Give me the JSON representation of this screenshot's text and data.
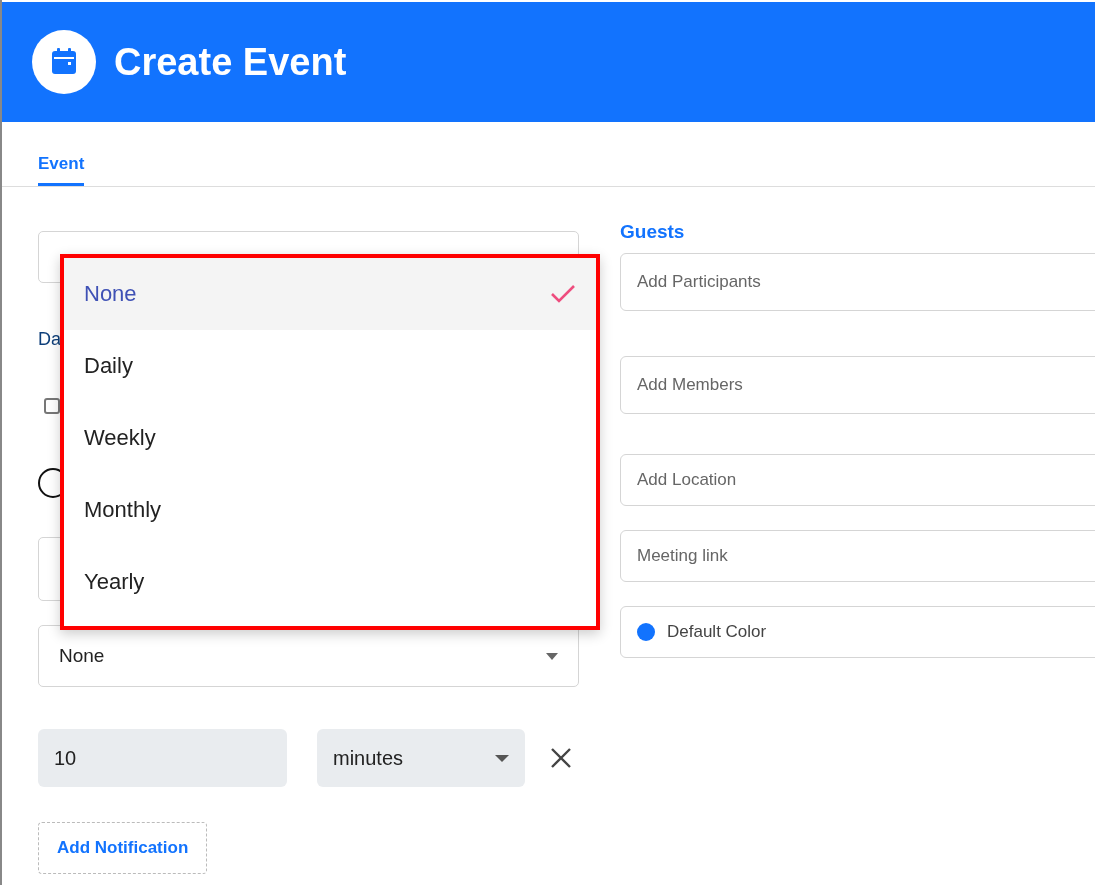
{
  "header": {
    "title": "Create Event"
  },
  "tabs": [
    {
      "label": "Event",
      "selected": true
    }
  ],
  "form": {
    "date_label": "Da",
    "all_day": {
      "checked": false
    },
    "repeat_select": {
      "value": "None"
    },
    "notification": {
      "amount": "10",
      "unit": "minutes"
    },
    "add_notification": "Add Notification"
  },
  "guests": {
    "label": "Guests",
    "fields": [
      {
        "placeholder": "Add Participants"
      },
      {
        "placeholder": "Add Members"
      },
      {
        "placeholder": "Add Location"
      },
      {
        "placeholder": "Meeting link"
      }
    ],
    "color_field": {
      "label": "Default Color",
      "color": "#1273fe"
    }
  },
  "dropdown": {
    "options": [
      {
        "label": "None",
        "selected": true
      },
      {
        "label": "Daily",
        "selected": false
      },
      {
        "label": "Weekly",
        "selected": false
      },
      {
        "label": "Monthly",
        "selected": false
      },
      {
        "label": "Yearly",
        "selected": false
      }
    ]
  }
}
